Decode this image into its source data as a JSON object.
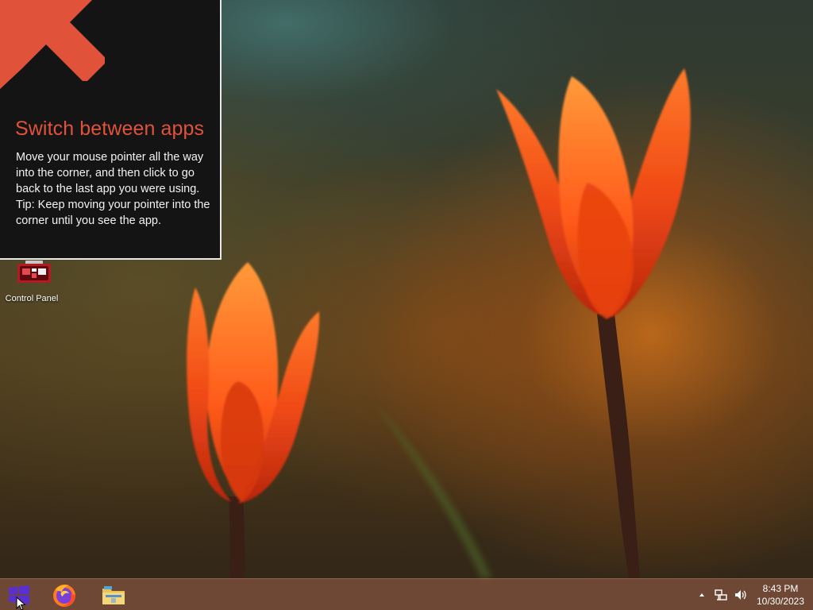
{
  "tip": {
    "title": "Switch between apps",
    "paragraph1": "Move your mouse pointer all the way into the corner, and then click to go back to the last app you were using.",
    "paragraph2": "Tip: Keep moving your pointer into the corner until you see the app.",
    "accent_color": "#e0523a",
    "arrow_icon": "arrow-up-left-icon"
  },
  "desktop_icons": [
    {
      "label": "Control Panel",
      "icon": "control-panel-icon"
    }
  ],
  "taskbar": {
    "start_icon": "windows-logo-icon",
    "pinned": [
      {
        "name": "Firefox",
        "icon": "firefox-icon"
      },
      {
        "name": "File Explorer",
        "icon": "folder-icon"
      }
    ],
    "tray": {
      "icons": [
        "chevron-up-icon",
        "network-icon",
        "speaker-icon"
      ],
      "time": "8:43 PM",
      "date": "10/30/2023"
    },
    "color": "#80523e"
  }
}
